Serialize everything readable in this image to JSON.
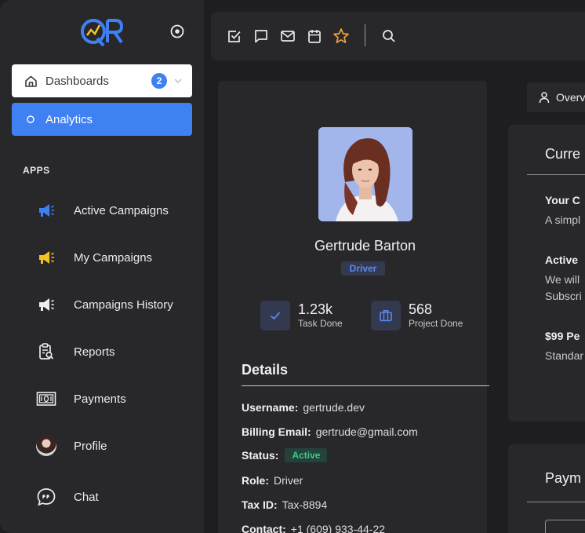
{
  "sidebar": {
    "menu": [
      {
        "label": "Dashboards",
        "badge": "2",
        "icon": "home-icon"
      },
      {
        "label": "Analytics",
        "icon": "circle-icon"
      }
    ],
    "section_label": "APPS",
    "apps": [
      {
        "label": "Active Campaigns",
        "icon": "megaphone-icon"
      },
      {
        "label": "My Campaigns",
        "icon": "megaphone-icon"
      },
      {
        "label": "Campaigns History",
        "icon": "megaphone-icon"
      },
      {
        "label": "Reports",
        "icon": "clipboard-search-icon"
      },
      {
        "label": "Payments",
        "icon": "cash-icon"
      },
      {
        "label": "Profile",
        "icon": "avatar"
      },
      {
        "label": "Chat",
        "icon": "chat-quote-icon"
      }
    ]
  },
  "topbar": {
    "icons": [
      "checkbox-icon",
      "message-icon",
      "mail-icon",
      "calendar-icon",
      "star-icon",
      "search-icon"
    ]
  },
  "profile": {
    "name": "Gertrude Barton",
    "role": "Driver",
    "stats": [
      {
        "value": "1.23k",
        "label": "Task Done",
        "icon": "check-icon"
      },
      {
        "value": "568",
        "label": "Project Done",
        "icon": "briefcase-icon"
      }
    ],
    "details_title": "Details",
    "details": [
      {
        "key": "Username:",
        "value": "gertrude.dev"
      },
      {
        "key": "Billing Email:",
        "value": "gertrude@gmail.com"
      },
      {
        "key": "Status:",
        "value": "Active"
      },
      {
        "key": "Role:",
        "value": "Driver"
      },
      {
        "key": "Tax ID:",
        "value": "Tax-8894"
      },
      {
        "key": "Contact:",
        "value": "+1 (609) 933-44-22"
      }
    ]
  },
  "right": {
    "tab_label": "Overv",
    "card1": {
      "title": "Curre",
      "items": [
        {
          "title": "Your C",
          "lines": [
            "A simpl"
          ]
        },
        {
          "title": "Active",
          "lines": [
            "We will",
            "Subscri"
          ]
        },
        {
          "title": "$99 Pe",
          "lines": [
            "Standar"
          ]
        }
      ]
    },
    "card2": {
      "title": "Paym"
    }
  },
  "colors": {
    "accent": "#3f80f3",
    "star": "#f0a23a",
    "megaphone_blue": "#3f80f3",
    "megaphone_yellow": "#f3c32a",
    "active_green": "#3dc98a"
  }
}
